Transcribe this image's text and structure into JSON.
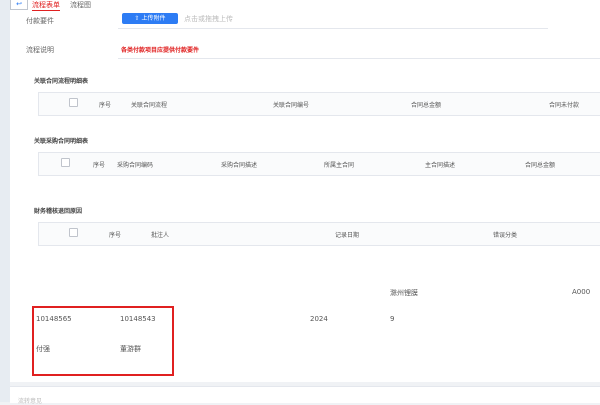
{
  "tabs": [
    "流程表单",
    "流程图"
  ],
  "form": {
    "attachment_label": "付款要件",
    "upload_button": "上传附件",
    "upload_hint": "点击或拖拽上传",
    "desc_label": "流程说明",
    "desc_note": "各类付款项目应提供付款要件"
  },
  "contract_table": {
    "title": "关联合同流程明细表",
    "columns": [
      "序号",
      "关联合同流程",
      "关联合同编号",
      "合同总金额",
      "合同未付款"
    ]
  },
  "purchase_table": {
    "title": "关联采购合同明细表",
    "columns": [
      "序号",
      "采购合同编码",
      "采购合同描述",
      "所属主合同",
      "主合同描述",
      "合同总金额"
    ]
  },
  "finance_table": {
    "title": "财务稽核退回原因",
    "columns": [
      "序号",
      "批注人",
      "记录日期",
      "错误分类"
    ]
  },
  "extra": {
    "location": "滁州锂膜",
    "code": "A000",
    "id1": "10148565",
    "id2": "10148543",
    "year": "2024",
    "num": "9",
    "name1": "付强",
    "name2": "董游群"
  },
  "footer": {
    "label": "流转意见"
  }
}
